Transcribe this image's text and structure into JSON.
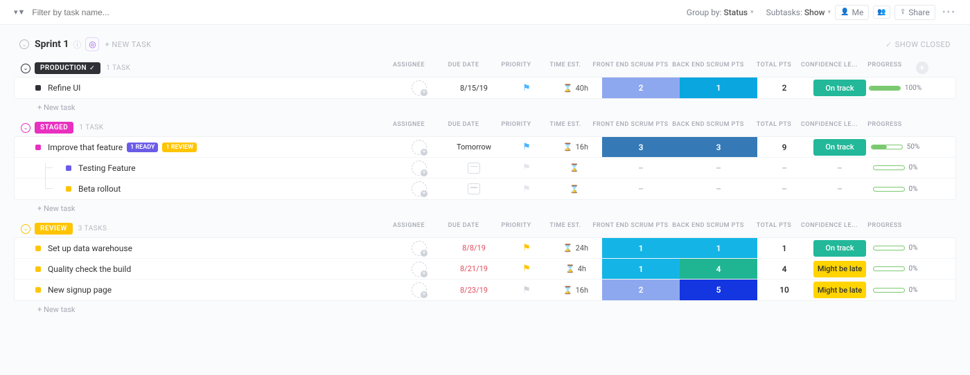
{
  "toolbar": {
    "filter_placeholder": "Filter by task name...",
    "group_by_label": "Group by:",
    "group_by_value": "Status",
    "subtasks_label": "Subtasks:",
    "subtasks_value": "Show",
    "me_label": "Me",
    "share_label": "Share"
  },
  "sprint": {
    "title": "Sprint 1",
    "new_task_label": "+ NEW TASK",
    "show_closed_label": "SHOW CLOSED"
  },
  "columns": {
    "assignee": "ASSIGNEE",
    "due_date": "DUE DATE",
    "priority": "PRIORITY",
    "time_est": "TIME EST.",
    "front_scrum": "FRONT END SCRUM PTS",
    "back_scrum": "BACK END SCRUM PTS",
    "total_pts": "TOTAL PTS",
    "confidence": "CONFIDENCE LE...",
    "progress": "PROGRESS"
  },
  "statuses": {
    "production": {
      "label": "PRODUCTION",
      "color": "#2f3136",
      "count_label": "1 TASK"
    },
    "staged": {
      "label": "STAGED",
      "color": "#e930c0",
      "count_label": "1 TASK"
    },
    "review": {
      "label": "REVIEW",
      "color": "#ffc400",
      "count_label": "3 TASKS"
    }
  },
  "confidence_colors": {
    "on_track": "#23b89a",
    "might_be_late": "#ffd400"
  },
  "groups": {
    "production": {
      "rows": [
        {
          "title": "Refine UI",
          "sq": "#2f3136",
          "due": "8/15/19",
          "due_red": false,
          "flag_color": "#4fb6ff",
          "time": "40h",
          "front": {
            "v": "2",
            "bg": "#8ea8ef"
          },
          "back": {
            "v": "1",
            "bg": "#0aa6e0"
          },
          "total": "2",
          "confidence": {
            "label": "On track",
            "key": "on_track",
            "text": "#fff"
          },
          "progress": {
            "pct": 100
          }
        }
      ],
      "footer": "+ New task"
    },
    "staged": {
      "rows": [
        {
          "title": "Improve that feature",
          "sq": "#e930c0",
          "tags": [
            {
              "label": "1 READY",
              "bg": "#6b5ce7"
            },
            {
              "label": "1 REVIEW",
              "bg": "#ffc400"
            }
          ],
          "due": "Tomorrow",
          "due_red": false,
          "flag_color": "#4fb6ff",
          "time": "16h",
          "front": {
            "v": "3",
            "bg": "#357ab7"
          },
          "back": {
            "v": "3",
            "bg": "#357ab7"
          },
          "total": "9",
          "confidence": {
            "label": "On track",
            "key": "on_track",
            "text": "#fff"
          },
          "progress": {
            "pct": 50
          }
        },
        {
          "title": "Testing Feature",
          "sq": "#6b5ce7",
          "indent": true,
          "empty": true,
          "progress": {
            "pct": 0
          }
        },
        {
          "title": "Beta rollout",
          "sq": "#ffc400",
          "indent": true,
          "empty": true,
          "progress": {
            "pct": 0
          }
        }
      ],
      "footer": "+ New task"
    },
    "review": {
      "rows": [
        {
          "title": "Set up data warehouse",
          "sq": "#ffc400",
          "due": "8/8/19",
          "due_red": true,
          "flag_color": "#ffc400",
          "time": "24h",
          "front": {
            "v": "1",
            "bg": "#14b5e6"
          },
          "back": {
            "v": "1",
            "bg": "#14b5e6"
          },
          "total": "1",
          "confidence": {
            "label": "On track",
            "key": "on_track",
            "text": "#fff"
          },
          "progress": {
            "pct": 0
          }
        },
        {
          "title": "Quality check the build",
          "sq": "#ffc400",
          "due": "8/21/19",
          "due_red": true,
          "flag_color": "#ffc400",
          "time": "4h",
          "front": {
            "v": "1",
            "bg": "#14b5e6"
          },
          "back": {
            "v": "4",
            "bg": "#1fb592"
          },
          "total": "4",
          "confidence": {
            "label": "Might be late",
            "key": "might_be_late",
            "text": "#333"
          },
          "progress": {
            "pct": 0
          }
        },
        {
          "title": "New signup page",
          "sq": "#ffc400",
          "due": "8/23/19",
          "due_red": true,
          "flag_color": "#cfd3da",
          "time": "16h",
          "front": {
            "v": "2",
            "bg": "#8ea8ef"
          },
          "back": {
            "v": "5",
            "bg": "#1336e0"
          },
          "total": "10",
          "confidence": {
            "label": "Might be late",
            "key": "might_be_late",
            "text": "#333"
          },
          "progress": {
            "pct": 0
          }
        }
      ],
      "footer": "+ New task"
    }
  }
}
